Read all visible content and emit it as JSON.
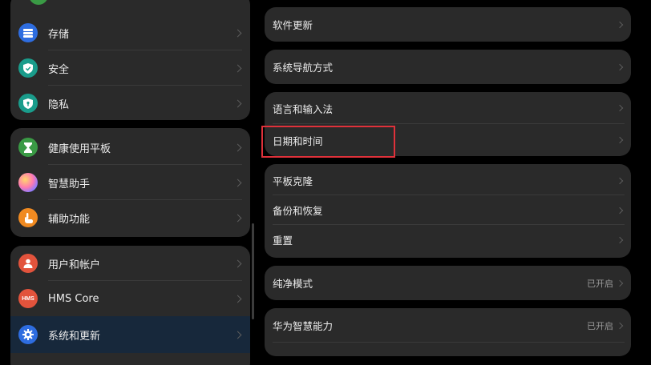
{
  "left": {
    "group1": [
      {
        "label": "存储",
        "icon": "storage-icon",
        "color": "#2e6de0"
      },
      {
        "label": "安全",
        "icon": "shield-check-icon",
        "color": "#1a9c8b"
      },
      {
        "label": "隐私",
        "icon": "privacy-shield-icon",
        "color": "#1a9c8b"
      }
    ],
    "group2": [
      {
        "label": "健康使用平板",
        "icon": "hourglass-icon",
        "color": "#3a9a45"
      },
      {
        "label": "智慧助手",
        "icon": "assistant-icon",
        "color": "#b06de0"
      },
      {
        "label": "辅助功能",
        "icon": "hand-icon",
        "color": "#f08a21"
      }
    ],
    "group3": [
      {
        "label": "用户和帐户",
        "icon": "user-icon",
        "color": "#e2533c"
      },
      {
        "label": "HMS Core",
        "icon": "hms-core-icon",
        "icon_text": "HMS",
        "color": "#e2533c"
      },
      {
        "label": "系统和更新",
        "icon": "gear-icon",
        "color": "#2e6de0"
      }
    ]
  },
  "right": {
    "software_update": "软件更新",
    "system_navigation": "系统导航方式",
    "language_input": "语言和输入法",
    "date_time": "日期和时间",
    "tablet_clone": "平板克隆",
    "backup_restore": "备份和恢复",
    "reset": "重置",
    "pure_mode": {
      "label": "纯净模式",
      "value": "已开启"
    },
    "huawei_smart": {
      "label": "华为智慧能力",
      "value": "已开启"
    }
  },
  "colors": {
    "background": "#000000",
    "card": "#2a2a2a",
    "active_row": "#17283b",
    "highlight": "#e0313a"
  }
}
